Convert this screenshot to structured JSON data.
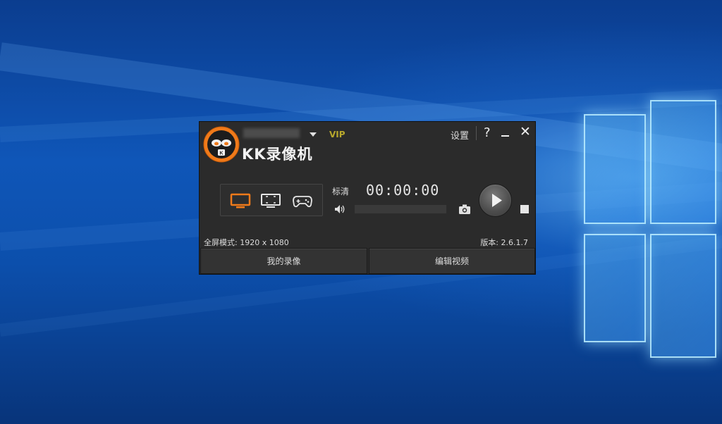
{
  "app": {
    "title": "KK录像机",
    "vip_label": "VIP",
    "settings_label": "设置",
    "help_label": "?",
    "close_label": "✕"
  },
  "modes": {
    "items": [
      {
        "name": "fullscreen",
        "icon": "monitor-icon",
        "active": true
      },
      {
        "name": "region",
        "icon": "region-select-icon",
        "active": false
      },
      {
        "name": "game",
        "icon": "gamepad-icon",
        "active": false
      }
    ]
  },
  "recorder": {
    "quality_label": "标清",
    "timer": "00:00:00",
    "volume_icon": "speaker-icon",
    "camera_icon": "camera-icon",
    "play_icon": "play-icon",
    "stop_icon": "stop-icon"
  },
  "status": {
    "fullscreen_info": "全屏模式: 1920 x 1080",
    "version": "版本: 2.6.1.7"
  },
  "buttons": {
    "my_recordings": "我的录像",
    "edit_video": "编辑视频"
  },
  "colors": {
    "accent": "#f07a1a",
    "vip": "#b8a82c",
    "window_bg": "#2b2b2b"
  }
}
